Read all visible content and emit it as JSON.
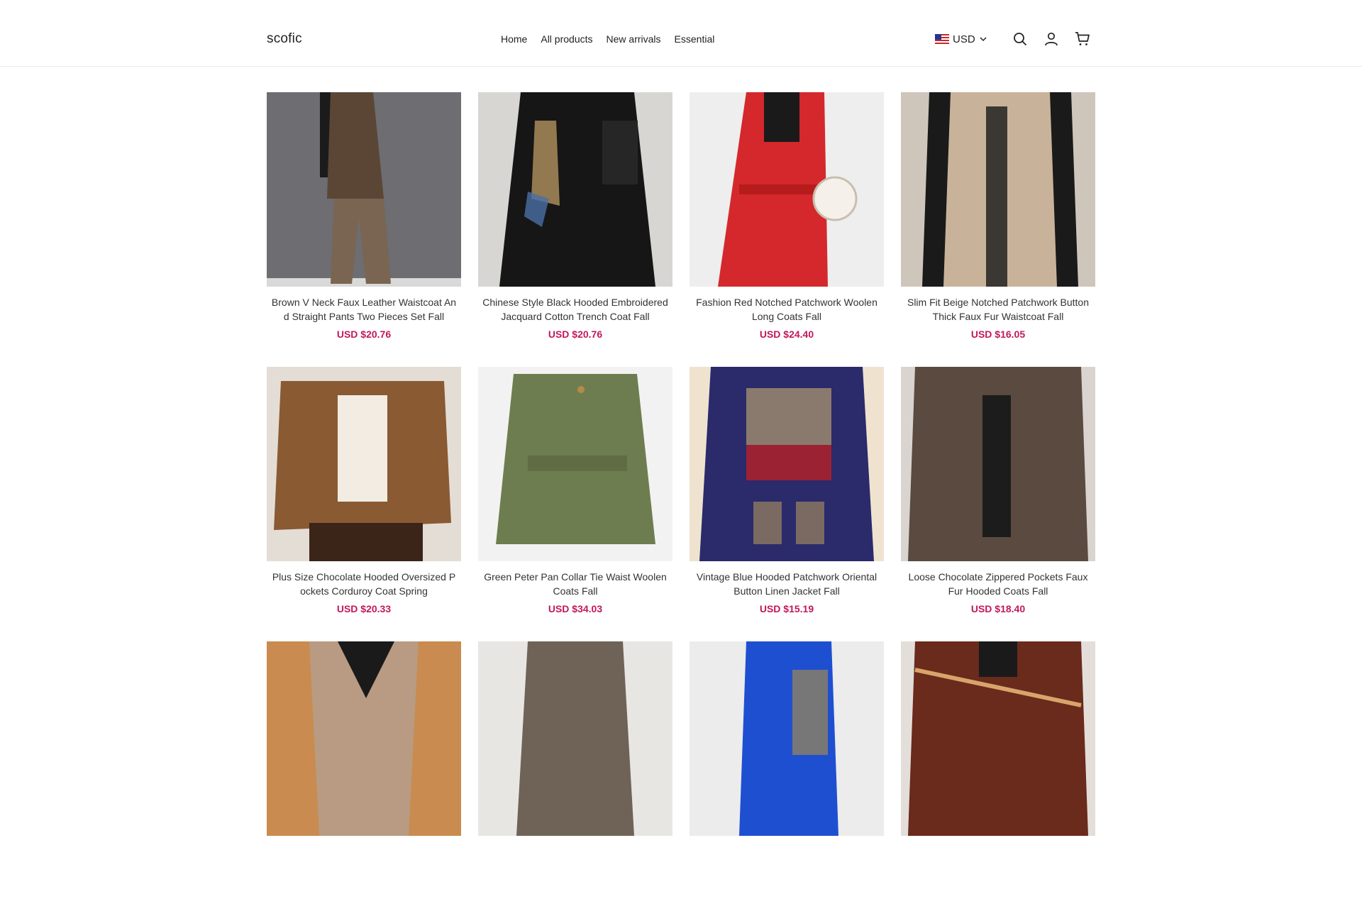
{
  "header": {
    "logo": "scofic",
    "nav": [
      {
        "label": "Home"
      },
      {
        "label": "All products"
      },
      {
        "label": "New arrivals"
      },
      {
        "label": "Essential"
      }
    ],
    "currency": "USD",
    "icons": [
      "us-flag-icon",
      "chevron-down-icon",
      "search-icon",
      "account-icon",
      "cart-icon"
    ]
  },
  "products": [
    {
      "title": "Brown V Neck Faux Leather Waistcoat And Straight Pants Two Pieces Set Fall",
      "price": "USD $20.76"
    },
    {
      "title": "Chinese Style Black Hooded Embroidered Jacquard Cotton Trench Coat Fall",
      "price": "USD $20.76"
    },
    {
      "title": "Fashion Red Notched Patchwork Woolen Long Coats Fall",
      "price": "USD $24.40"
    },
    {
      "title": "Slim Fit Beige Notched Patchwork Button Thick Faux Fur Waistcoat Fall",
      "price": "USD $16.05"
    },
    {
      "title": "Plus Size Chocolate Hooded Oversized Pockets Corduroy Coat Spring",
      "price": "USD $20.33"
    },
    {
      "title": "Green Peter Pan Collar Tie Waist Woolen Coats Fall",
      "price": "USD $34.03"
    },
    {
      "title": "Vintage Blue Hooded Patchwork Oriental Button Linen Jacket Fall",
      "price": "USD $15.19"
    },
    {
      "title": "Loose Chocolate Zippered Pockets Faux Fur Hooded Coats Fall",
      "price": "USD $18.40"
    },
    {
      "title": "",
      "price": ""
    },
    {
      "title": "",
      "price": ""
    },
    {
      "title": "",
      "price": ""
    },
    {
      "title": "",
      "price": ""
    }
  ],
  "colors": {
    "price": "#c2185b",
    "text": "#222222",
    "border": "#ececec"
  }
}
